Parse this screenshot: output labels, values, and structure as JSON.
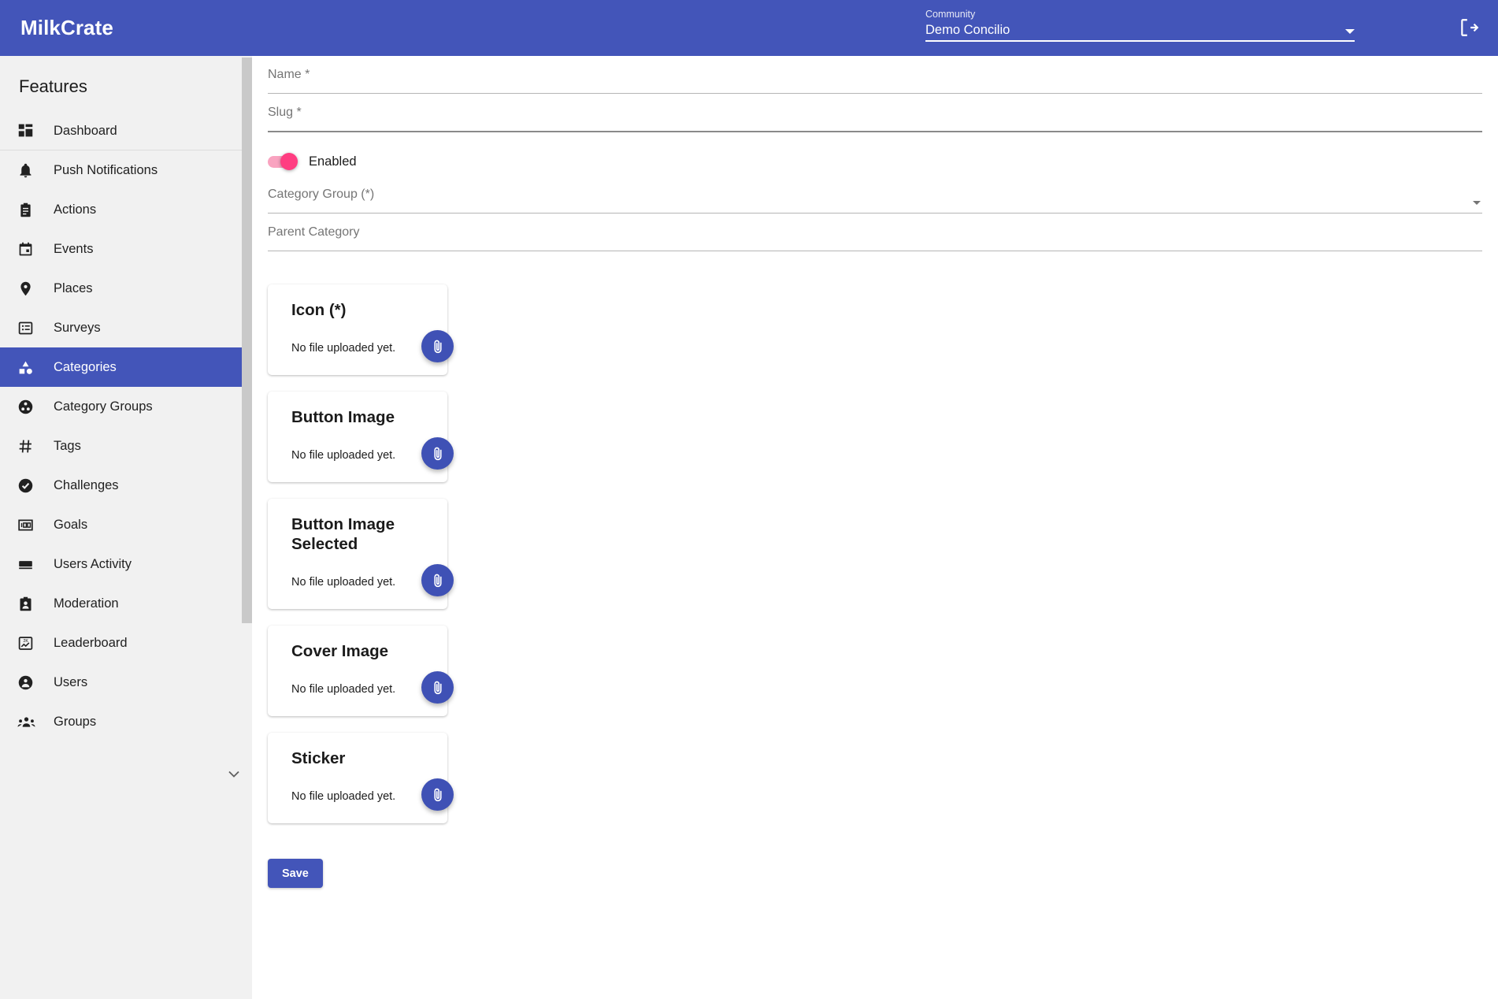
{
  "app": {
    "brand": "MilkCrate",
    "accent_color": "#4355b9",
    "toggle_color": "#ff3d81",
    "sidebar_bg": "#f1f1f1"
  },
  "header": {
    "community_label": "Community",
    "community_value": "Demo Concilio",
    "logout_icon": "logout-icon",
    "dropdown_icon": "chevron-down-icon"
  },
  "sidebar": {
    "title": "Features",
    "items": [
      {
        "label": "Dashboard",
        "icon": "dashboard-icon",
        "active": false
      },
      {
        "label": "Push Notifications",
        "icon": "bell-icon",
        "active": false
      },
      {
        "label": "Actions",
        "icon": "clipboard-icon",
        "active": false
      },
      {
        "label": "Events",
        "icon": "calendar-icon",
        "active": false
      },
      {
        "label": "Places",
        "icon": "map-pin-icon",
        "active": false
      },
      {
        "label": "Surveys",
        "icon": "list-box-icon",
        "active": false
      },
      {
        "label": "Categories",
        "icon": "category-shapes-icon",
        "active": true
      },
      {
        "label": "Category Groups",
        "icon": "group-circles-icon",
        "active": false
      },
      {
        "label": "Tags",
        "icon": "hash-icon",
        "active": false
      },
      {
        "label": "Challenges",
        "icon": "check-circle-icon",
        "active": false
      },
      {
        "label": "Goals",
        "icon": "score-100-icon",
        "active": false
      },
      {
        "label": "Users Activity",
        "icon": "activity-bar-icon",
        "active": false
      },
      {
        "label": "Moderation",
        "icon": "badge-person-icon",
        "active": false
      },
      {
        "label": "Leaderboard",
        "icon": "trend-chart-icon",
        "active": false
      },
      {
        "label": "Users",
        "icon": "user-circle-icon",
        "active": false
      },
      {
        "label": "Groups",
        "icon": "people-group-icon",
        "active": false
      }
    ],
    "scroll_chevron_icon": "chevron-down-icon"
  },
  "form": {
    "fields": [
      {
        "label": "Name *",
        "value": "",
        "type": "text",
        "hover": false
      },
      {
        "label": "Slug *",
        "value": "",
        "type": "text",
        "hover": true
      },
      {
        "label": "Category Group (*)",
        "value": "",
        "type": "select",
        "hover": false
      },
      {
        "label": "Parent Category",
        "value": "",
        "type": "text",
        "hover": false
      }
    ],
    "toggle": {
      "label": "Enabled",
      "on": true
    },
    "upload_cards": [
      {
        "title": "Icon (*)",
        "status": "No file uploaded yet.",
        "button_icon": "paperclip-icon"
      },
      {
        "title": "Button Image",
        "status": "No file uploaded yet.",
        "button_icon": "paperclip-icon"
      },
      {
        "title": "Button Image Selected",
        "status": "No file uploaded yet.",
        "button_icon": "paperclip-icon"
      },
      {
        "title": "Cover Image",
        "status": "No file uploaded yet.",
        "button_icon": "paperclip-icon"
      },
      {
        "title": "Sticker",
        "status": "No file uploaded yet.",
        "button_icon": "paperclip-icon"
      }
    ],
    "save_label": "Save"
  }
}
